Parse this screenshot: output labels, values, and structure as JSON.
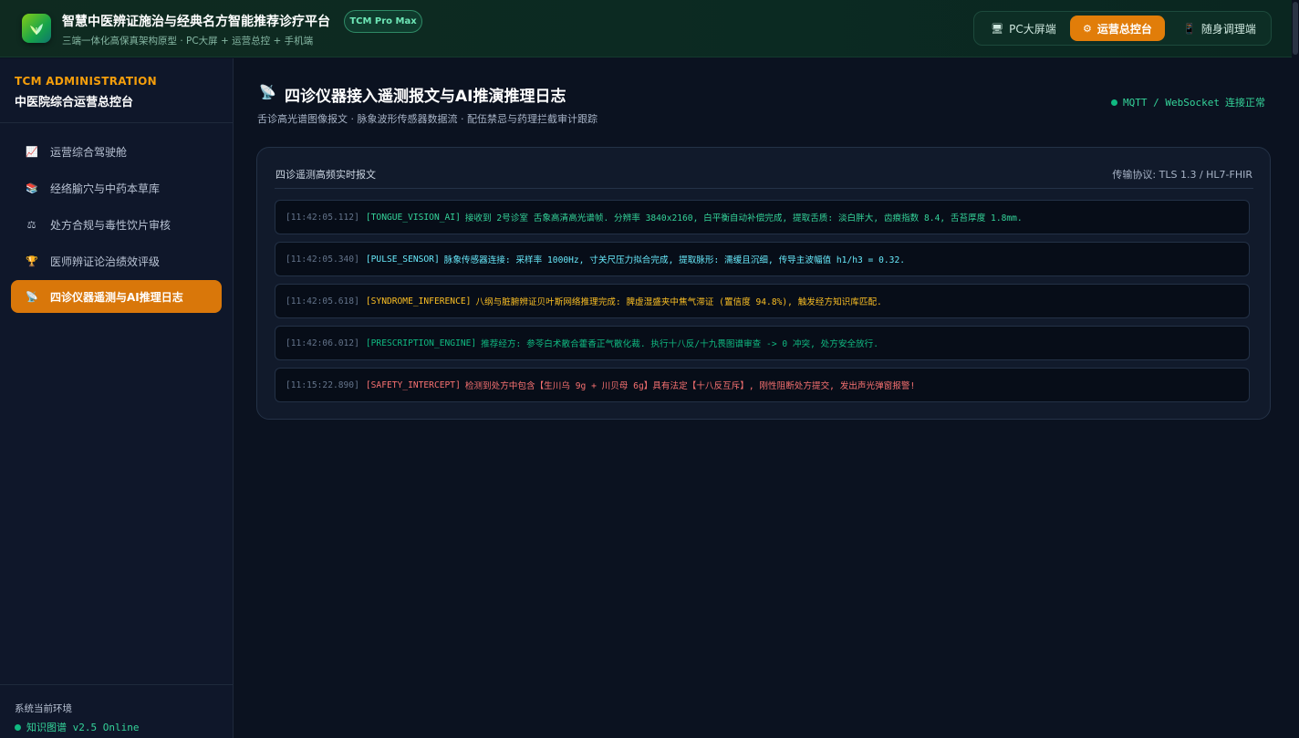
{
  "header": {
    "title": "智慧中医辨证施治与经典名方智能推荐诊疗平台",
    "badge": "TCM Pro Max",
    "subtitle": "三端一体化高保真架构原型 · PC大屏 + 运营总控 + 手机端",
    "logo_icon": "herb-leaf-icon",
    "modes": [
      {
        "label": "PC大屏端",
        "icon": "monitor-icon",
        "glyph": "🖥",
        "active": false
      },
      {
        "label": "运营总控台",
        "icon": "gear-icon",
        "glyph": "⚙",
        "active": true
      },
      {
        "label": "随身调理端",
        "icon": "mobile-phone-icon",
        "glyph": "📱",
        "active": false
      }
    ]
  },
  "sidebar": {
    "kicker": "TCM ADMINISTRATION",
    "title": "中医院综合运营总控台",
    "items": [
      {
        "label": "运营综合驾驶舱",
        "icon": "trend-chart-icon",
        "glyph": "📈",
        "active": false
      },
      {
        "label": "经络腧穴与中药本草库",
        "icon": "books-icon",
        "glyph": "📚",
        "active": false
      },
      {
        "label": "处方合规与毒性饮片审核",
        "icon": "scales-icon",
        "glyph": "⚖",
        "active": false
      },
      {
        "label": "医师辨证论治绩效评级",
        "icon": "trophy-icon",
        "glyph": "🏆",
        "active": false
      },
      {
        "label": "四诊仪器遥测与AI推理日志",
        "icon": "satellite-icon",
        "glyph": "📡",
        "active": true
      }
    ],
    "env_label": "系统当前环境",
    "env_status": "知识图谱 v2.5 Online"
  },
  "main": {
    "title_icon": "satellite-icon",
    "title_glyph": "📡",
    "title": "四诊仪器接入遥测报文与AI推演推理日志",
    "subtitle": "舌诊高光谱图像报文 · 脉象波形传感器数据流 · 配伍禁忌与药理拦截审计跟踪",
    "connection_protocol": "MQTT / WebSocket",
    "connection_state": "连接正常",
    "panel": {
      "title": "四诊遥测高频实时报文",
      "meta": "传输协议: TLS 1.3 / HL7-FHIR",
      "logs": [
        {
          "ts": "[11:42:05.112]",
          "tag": "[TONGUE_VISION_AI]",
          "msg": "接收到 2号诊室 舌象高清高光谱帧. 分辨率 3840x2160, 白平衡自动补偿完成, 提取舌质: 淡白胖大, 齿痕指数 8.4, 舌苔厚度 1.8mm.",
          "color": "#34d399"
        },
        {
          "ts": "[11:42:05.340]",
          "tag": "[PULSE_SENSOR]",
          "msg": "脉象传感器连接: 采样率 1000Hz, 寸关尺压力拟合完成, 提取脉形: 濡缓且沉细, 传导主波幅值 h1/h3 = 0.32.",
          "color": "#67e8f9"
        },
        {
          "ts": "[11:42:05.618]",
          "tag": "[SYNDROME_INFERENCE]",
          "msg": "八纲与脏腑辨证贝叶斯网络推理完成: 脾虚湿盛夹中焦气滞证 (置信度 94.8%), 触发经方知识库匹配.",
          "color": "#fbbf24"
        },
        {
          "ts": "[11:42:06.012]",
          "tag": "[PRESCRIPTION_ENGINE]",
          "msg": "推荐经方: 参苓白术散合藿香正气散化裁. 执行十八反/十九畏图谱审查 -> 0 冲突, 处方安全放行.",
          "color": "#10b981"
        },
        {
          "ts": "[11:15:22.890]",
          "tag": "[SAFETY_INTERCEPT]",
          "msg": "检测到处方中包含【生川乌 9g + 川贝母 6g】具有法定【十八反互斥】, 刚性阻断处方提交, 发出声光弹窗报警!",
          "color": "#f87171"
        }
      ]
    }
  }
}
